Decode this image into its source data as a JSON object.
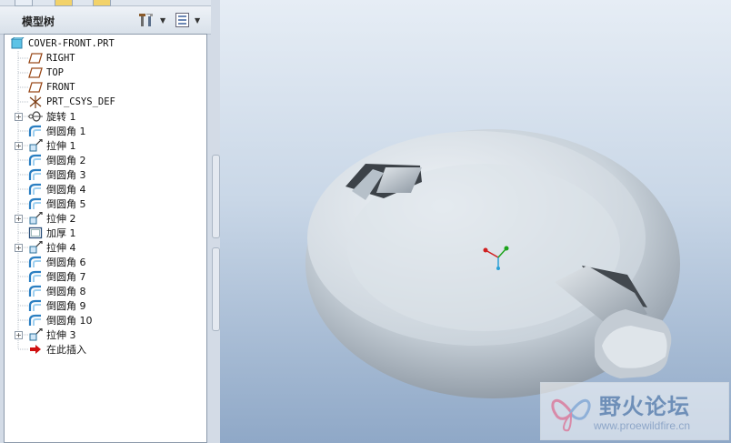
{
  "tree_panel": {
    "title": "模型树"
  },
  "tree": [
    {
      "label": "COVER-FRONT.PRT",
      "icon": "part-icon",
      "expander": false,
      "indent": 0
    },
    {
      "label": "RIGHT",
      "icon": "datum-plane-icon",
      "expander": false,
      "indent": 1
    },
    {
      "label": "TOP",
      "icon": "datum-plane-icon",
      "expander": false,
      "indent": 1
    },
    {
      "label": "FRONT",
      "icon": "datum-plane-icon",
      "expander": false,
      "indent": 1
    },
    {
      "label": "PRT_CSYS_DEF",
      "icon": "coordinate-system-icon",
      "expander": false,
      "indent": 1
    },
    {
      "label": "旋转 1",
      "icon": "revolve-icon",
      "expander": true,
      "indent": 1
    },
    {
      "label": "倒圆角 1",
      "icon": "round-icon",
      "expander": false,
      "indent": 1
    },
    {
      "label": "拉伸 1",
      "icon": "extrude-icon",
      "expander": true,
      "indent": 1
    },
    {
      "label": "倒圆角 2",
      "icon": "round-icon",
      "expander": false,
      "indent": 1
    },
    {
      "label": "倒圆角 3",
      "icon": "round-icon",
      "expander": false,
      "indent": 1
    },
    {
      "label": "倒圆角 4",
      "icon": "round-icon",
      "expander": false,
      "indent": 1
    },
    {
      "label": "倒圆角 5",
      "icon": "round-icon",
      "expander": false,
      "indent": 1
    },
    {
      "label": "拉伸 2",
      "icon": "extrude-icon",
      "expander": true,
      "indent": 1
    },
    {
      "label": "加厚 1",
      "icon": "thicken-icon",
      "expander": false,
      "indent": 1
    },
    {
      "label": "拉伸 4",
      "icon": "extrude-icon",
      "expander": true,
      "indent": 1
    },
    {
      "label": "倒圆角 6",
      "icon": "round-icon",
      "expander": false,
      "indent": 1
    },
    {
      "label": "倒圆角 7",
      "icon": "round-icon",
      "expander": false,
      "indent": 1
    },
    {
      "label": "倒圆角 8",
      "icon": "round-icon",
      "expander": false,
      "indent": 1
    },
    {
      "label": "倒圆角 9",
      "icon": "round-icon",
      "expander": false,
      "indent": 1
    },
    {
      "label": "倒圆角 10",
      "icon": "round-icon",
      "expander": false,
      "indent": 1
    },
    {
      "label": "拉伸 3",
      "icon": "extrude-icon",
      "expander": true,
      "indent": 1
    },
    {
      "label": "在此插入",
      "icon": "insert-here-arrow-icon",
      "expander": false,
      "indent": 1
    }
  ],
  "watermark": {
    "title": "野火论坛",
    "url": "www.proewildfire.cn"
  },
  "colors": {
    "viewport_top": "#e6edf5",
    "viewport_bottom": "#8fa8c7",
    "model_body": "#c3cdd6",
    "insert_arrow": "#d01010"
  }
}
